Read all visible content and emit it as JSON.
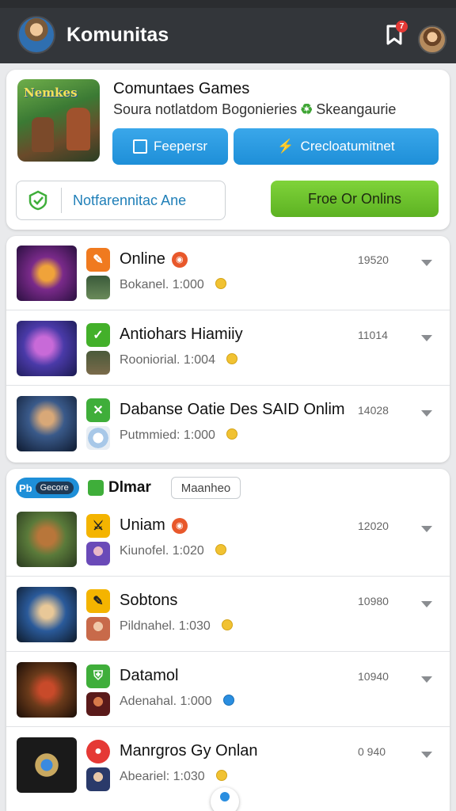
{
  "header": {
    "title": "Komunitas",
    "notification_count": "7"
  },
  "hero": {
    "game_logo": "Nemkes",
    "title": "Comuntaes Games",
    "subtitle_left": "Soura notlatdom Bogonieries",
    "subtitle_right": "Skeangaurie",
    "btn1_label": "Feepersr",
    "btn2_label": "Crecloatumitnet",
    "outline_label": "Notfarennitac Ane",
    "green_label": "Froe Or Onlins"
  },
  "list1": [
    {
      "name": "Online",
      "meta": "Bokanel. 1:000",
      "num": "19520",
      "badge_color": "#f07a1f",
      "dot": true,
      "coin": "gold"
    },
    {
      "name": "Antiohars Hiamiiy",
      "meta": "Rooniorial. 1:004",
      "num": "11014",
      "badge_color": "#43b02a",
      "dot": false,
      "coin": "gold"
    },
    {
      "name": "Dabanse Oatie Des SAID Onlim",
      "meta": "Putmmied: 1:000",
      "num": "14028",
      "badge_color": "#3fae3a",
      "dot": false,
      "coin": "gold"
    }
  ],
  "filters": {
    "pill_prefix": "Pb",
    "pill_inner": "Gecore",
    "tag": "Dlmar",
    "outline": "Maanheo"
  },
  "list2": [
    {
      "name": "Uniam",
      "meta": "Kiunofel. 1:020",
      "num": "12020",
      "badge_color": "#f4b400",
      "dot": true,
      "coin": "gold"
    },
    {
      "name": "Sobtons",
      "meta": "Pildnahel. 1:030",
      "num": "10980",
      "badge_color": "#f4b400",
      "dot": false,
      "coin": "gold"
    },
    {
      "name": "Datamol",
      "meta": "Adenahal. 1:000",
      "num": "10940",
      "badge_color": "#3fae3a",
      "dot": false,
      "coin": "blue"
    },
    {
      "name": "Manrgros Gy Onlan",
      "meta": "Abeariel: 1:030",
      "num": "0 940",
      "badge_color": "#e53935",
      "dot": false,
      "coin": "gold"
    }
  ]
}
